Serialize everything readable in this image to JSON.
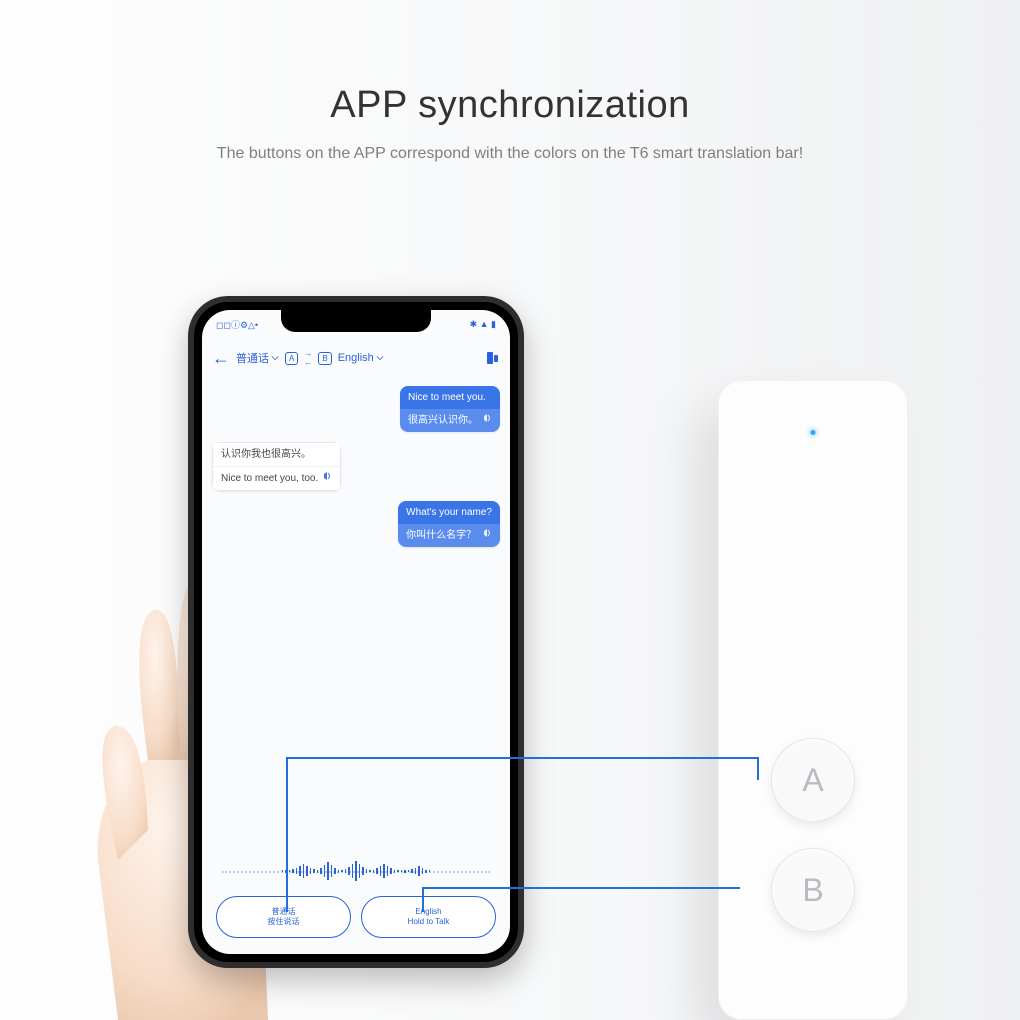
{
  "headline": {
    "title": "APP synchronization",
    "subtitle": "The buttons on the APP correspond with the colors on the T6 smart translation bar!"
  },
  "status": {
    "timeicons": "◻◻ⓘ⚙△•",
    "right": "✱ ▲ ▮"
  },
  "header": {
    "lang_a": "普通话",
    "badge_a": "A",
    "badge_b": "B",
    "lang_b": "English"
  },
  "chat": [
    {
      "dir": "out",
      "line1": "Nice to meet you.",
      "line2": "很高兴认识你。"
    },
    {
      "dir": "in",
      "line1": "认识你我也很高兴。",
      "line2": "Nice to meet you, too."
    },
    {
      "dir": "out",
      "line1": "What's your name?",
      "line2": "你叫什么名字？"
    }
  ],
  "talk": {
    "a_line1": "普通话",
    "a_line2": "按住说话",
    "b_line1": "English",
    "b_line2": "Hold to Talk"
  },
  "device": {
    "btn_a": "A",
    "btn_b": "B"
  }
}
